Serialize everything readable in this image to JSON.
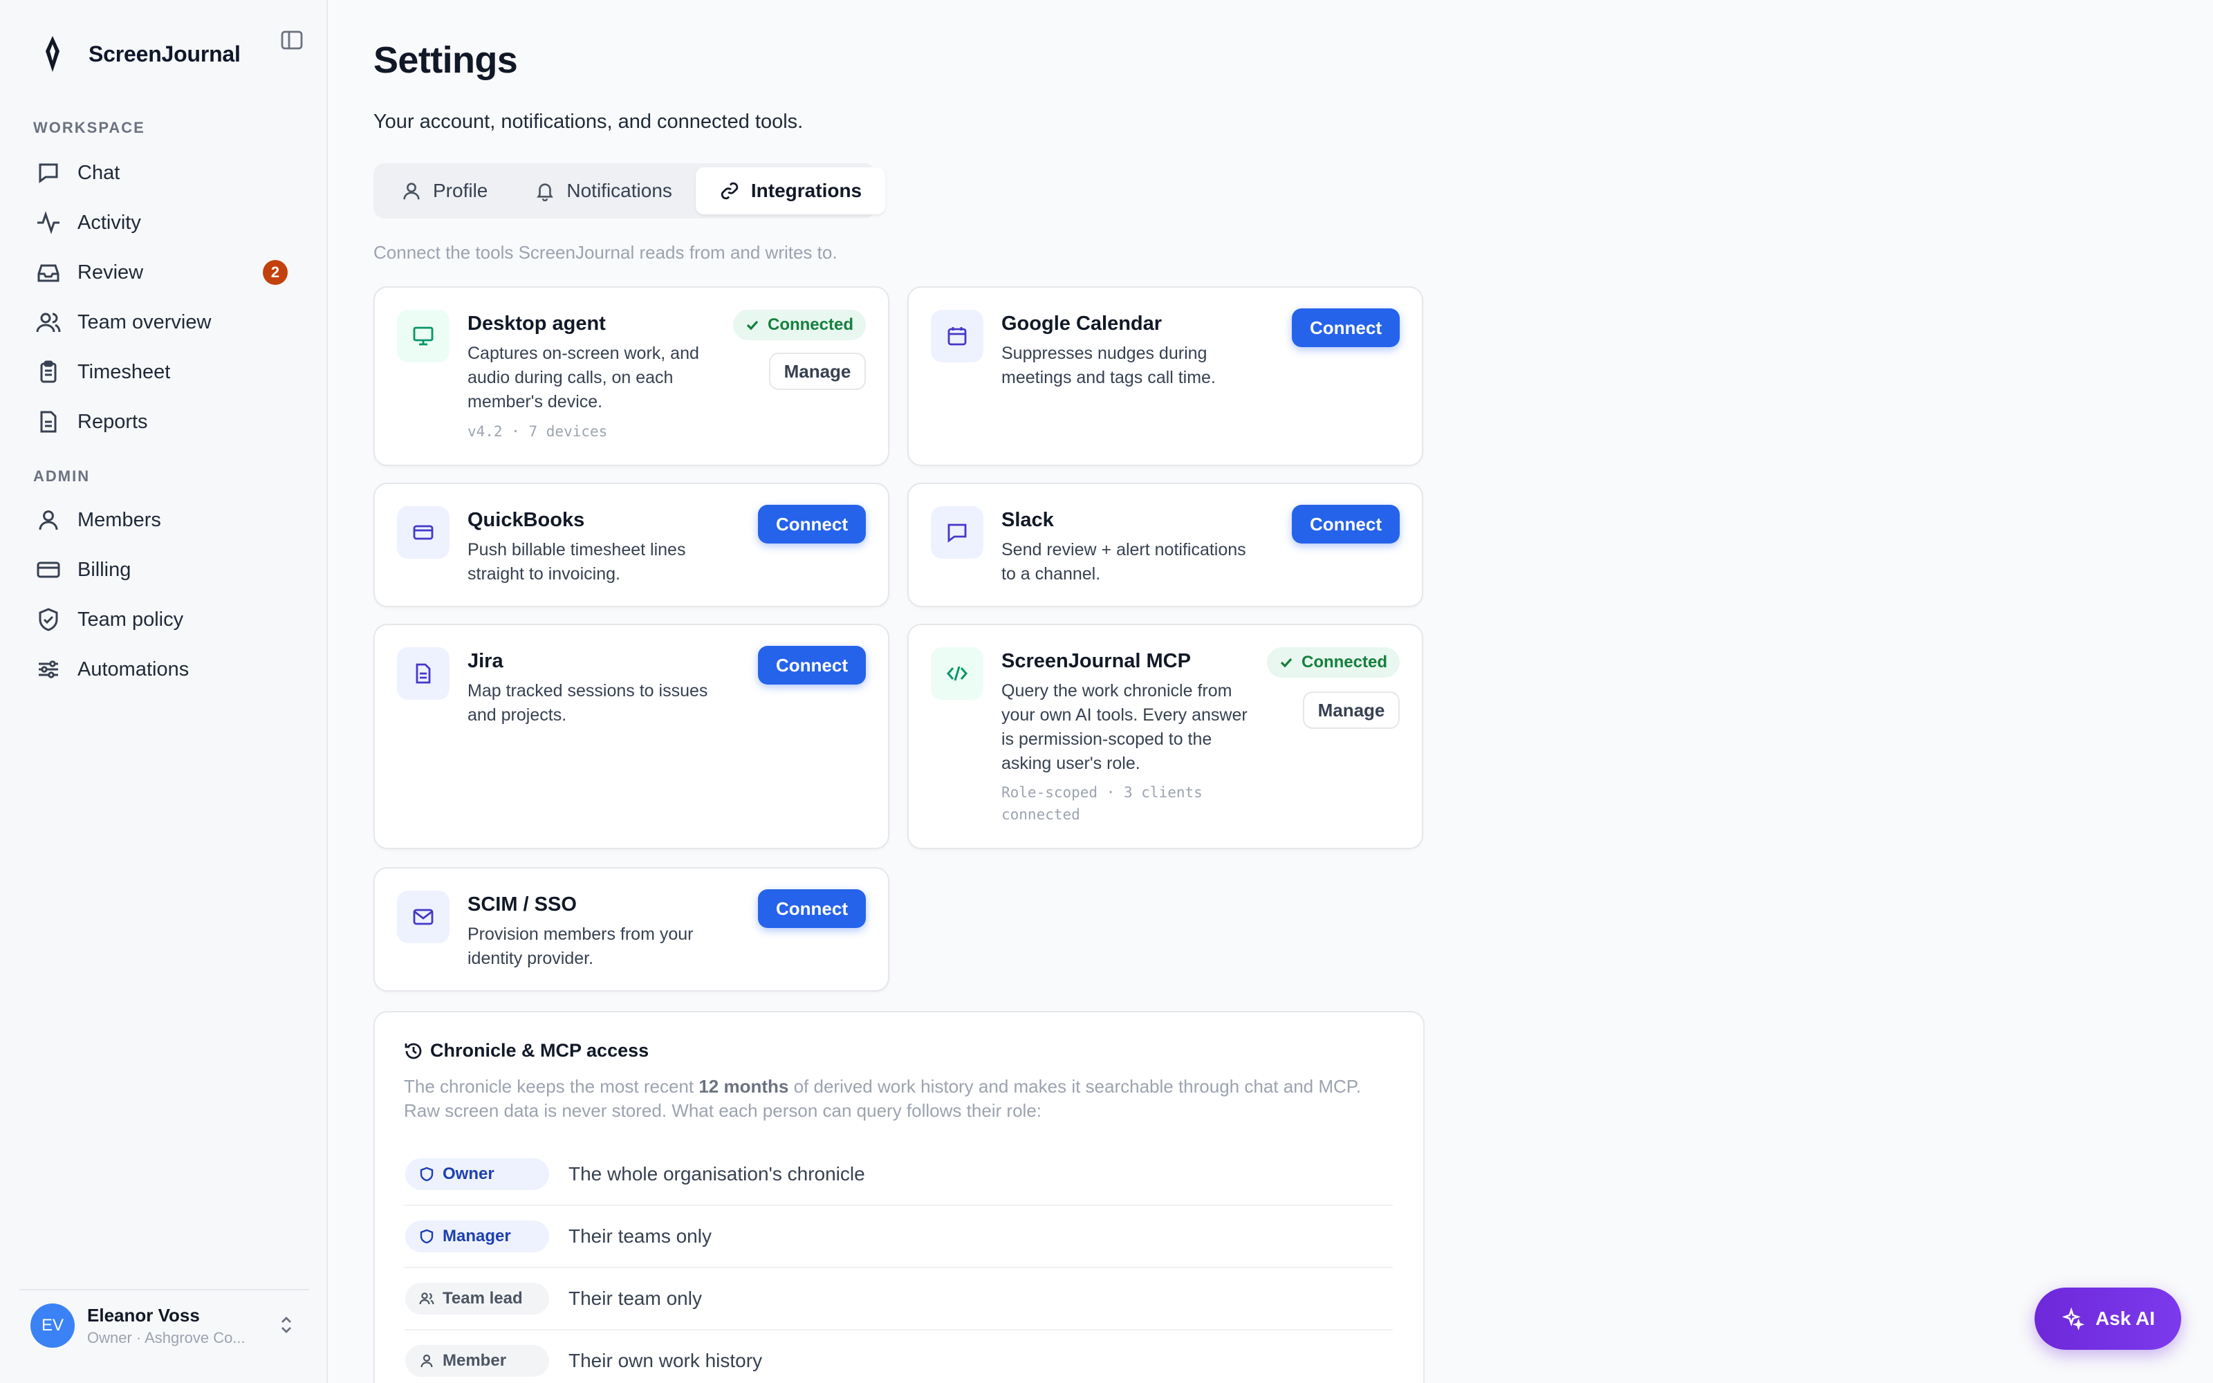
{
  "brand": {
    "name": "ScreenJournal"
  },
  "sidebar": {
    "sections": {
      "workspace": "WORKSPACE",
      "admin": "ADMIN"
    },
    "workspace_items": [
      {
        "label": "Chat",
        "icon": "chat-icon"
      },
      {
        "label": "Activity",
        "icon": "activity-icon"
      },
      {
        "label": "Review",
        "icon": "inbox-icon",
        "badge": "2"
      },
      {
        "label": "Team overview",
        "icon": "users-icon"
      },
      {
        "label": "Timesheet",
        "icon": "clipboard-icon"
      },
      {
        "label": "Reports",
        "icon": "file-icon"
      }
    ],
    "admin_items": [
      {
        "label": "Members",
        "icon": "user-icon"
      },
      {
        "label": "Billing",
        "icon": "credit-card-icon"
      },
      {
        "label": "Team policy",
        "icon": "shield-check-icon"
      },
      {
        "label": "Automations",
        "icon": "sliders-icon"
      }
    ],
    "user": {
      "initials": "EV",
      "name": "Eleanor Voss",
      "role": "Owner · Ashgrove Co..."
    }
  },
  "page": {
    "title": "Settings",
    "subtitle": "Your account, notifications, and connected tools.",
    "tabs": [
      {
        "label": "Profile",
        "icon": "user-icon"
      },
      {
        "label": "Notifications",
        "icon": "bell-icon"
      },
      {
        "label": "Integrations",
        "icon": "link-icon",
        "active": true
      }
    ],
    "helper": "Connect the tools ScreenJournal reads from and writes to."
  },
  "integrations": [
    {
      "title": "Desktop agent",
      "desc": "Captures on-screen work, and audio during calls, on each member's device.",
      "meta": "v4.2 · 7 devices",
      "status": "Connected",
      "action": "Manage",
      "icon": "monitor-icon"
    },
    {
      "title": "Google Calendar",
      "desc": "Suppresses nudges during meetings and tags call time.",
      "action": "Connect",
      "icon": "calendar-icon"
    },
    {
      "title": "QuickBooks",
      "desc": "Push billable timesheet lines straight to invoicing.",
      "action": "Connect",
      "icon": "credit-card-icon"
    },
    {
      "title": "Slack",
      "desc": "Send review + alert notifications to a channel.",
      "action": "Connect",
      "icon": "chat-icon"
    },
    {
      "title": "Jira",
      "desc": "Map tracked sessions to issues and projects.",
      "action": "Connect",
      "icon": "file-icon"
    },
    {
      "title": "ScreenJournal MCP",
      "desc": "Query the work chronicle from your own AI tools. Every answer is permission-scoped to the asking user's role.",
      "meta": "Role-scoped · 3 clients connected",
      "status": "Connected",
      "action": "Manage",
      "icon": "code-icon"
    },
    {
      "title": "SCIM / SSO",
      "desc": "Provision members from your identity provider.",
      "action": "Connect",
      "icon": "mail-icon"
    }
  ],
  "access": {
    "title": "Chronicle & MCP access",
    "desc_before": "The chronicle keeps the most recent ",
    "desc_bold": "12 months",
    "desc_after": " of derived work history and makes it searchable through chat and MCP. Raw screen data is never stored. What each person can query follows their role:",
    "roles": [
      {
        "role": "Owner",
        "access": "The whole organisation's chronicle",
        "icon": "shield-icon"
      },
      {
        "role": "Manager",
        "access": "Their teams only",
        "icon": "shield-icon"
      },
      {
        "role": "Team lead",
        "access": "Their team only",
        "icon": "users-icon"
      },
      {
        "role": "Member",
        "access": "Their own work history",
        "icon": "user-icon"
      }
    ]
  },
  "ask_ai": {
    "label": "Ask AI"
  },
  "colors": {
    "accent": "#2563eb",
    "connected": "#15803d",
    "badge": "#c2410c",
    "ask_ai": "#6d28d9"
  }
}
